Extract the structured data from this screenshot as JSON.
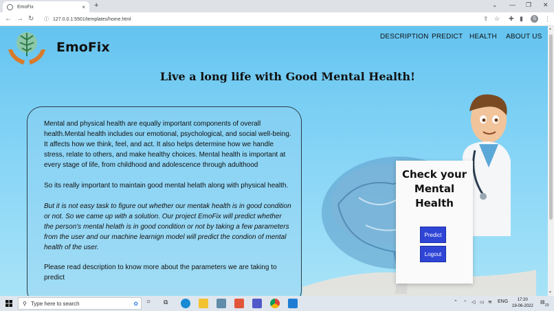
{
  "browser": {
    "tab_title": "EmoFix",
    "tab_close": "×",
    "new_tab": "+",
    "url": "127.0.0.1:5501/templates/home.html",
    "profile_initial": "S",
    "controls": {
      "chevron": "⌄",
      "minimize": "—",
      "maximize": "❐",
      "close": "✕"
    }
  },
  "site": {
    "brand": "EmoFix",
    "nav": [
      "DESCRIPTION",
      "PREDICT",
      "HEALTH",
      "ABOUT US"
    ],
    "headline": "Live a long life with Good Mental Health!",
    "paragraphs": [
      "Mental and physical health are equally important components of overall health.Mental health includes our emotional, psychological, and social well-being. It affects how we think, feel, and act. It also helps determine how we handle stress, relate to others, and make healthy choices. Mental health is important at every stage of life, from childhood and adolescence through adulthood",
      "So its really important to maintain good mental helath along with physical health.",
      "But it is not easy task to figure out whether our mentak health is in good condition or not. So we came up with a solution. Our project EmoFix will predict whether the person's mental helath is in good condition or not by taking a few parameters from the user and our machine learnign model will predict the condion of mental health of the user.",
      "Please read description to know more about the parameters we are taking to predict"
    ],
    "poster": {
      "line1": "Check your",
      "line2": "Mental",
      "line3": "Health",
      "predict_button": "Predict",
      "logout_button": "Logout"
    }
  },
  "taskbar": {
    "search_placeholder": "Type here to search",
    "language": "ENG",
    "time": "17:20",
    "date": "19-06-2022",
    "notification_count": "23"
  },
  "colors": {
    "accent_button": "#2f45d6",
    "page_bg": "#7acff4"
  },
  "icons": [
    "chrome-favicon-icon",
    "back-icon",
    "forward-icon",
    "reload-icon",
    "info-icon",
    "share-icon",
    "star-icon",
    "extensions-icon",
    "sidebar-icon",
    "menu-icon",
    "windows-icon",
    "search-icon",
    "cortana-icon",
    "task-view-icon",
    "edge-icon",
    "file-explorer-icon",
    "store-icon",
    "photos-icon",
    "teams-icon",
    "chrome-icon",
    "vscode-icon"
  ]
}
